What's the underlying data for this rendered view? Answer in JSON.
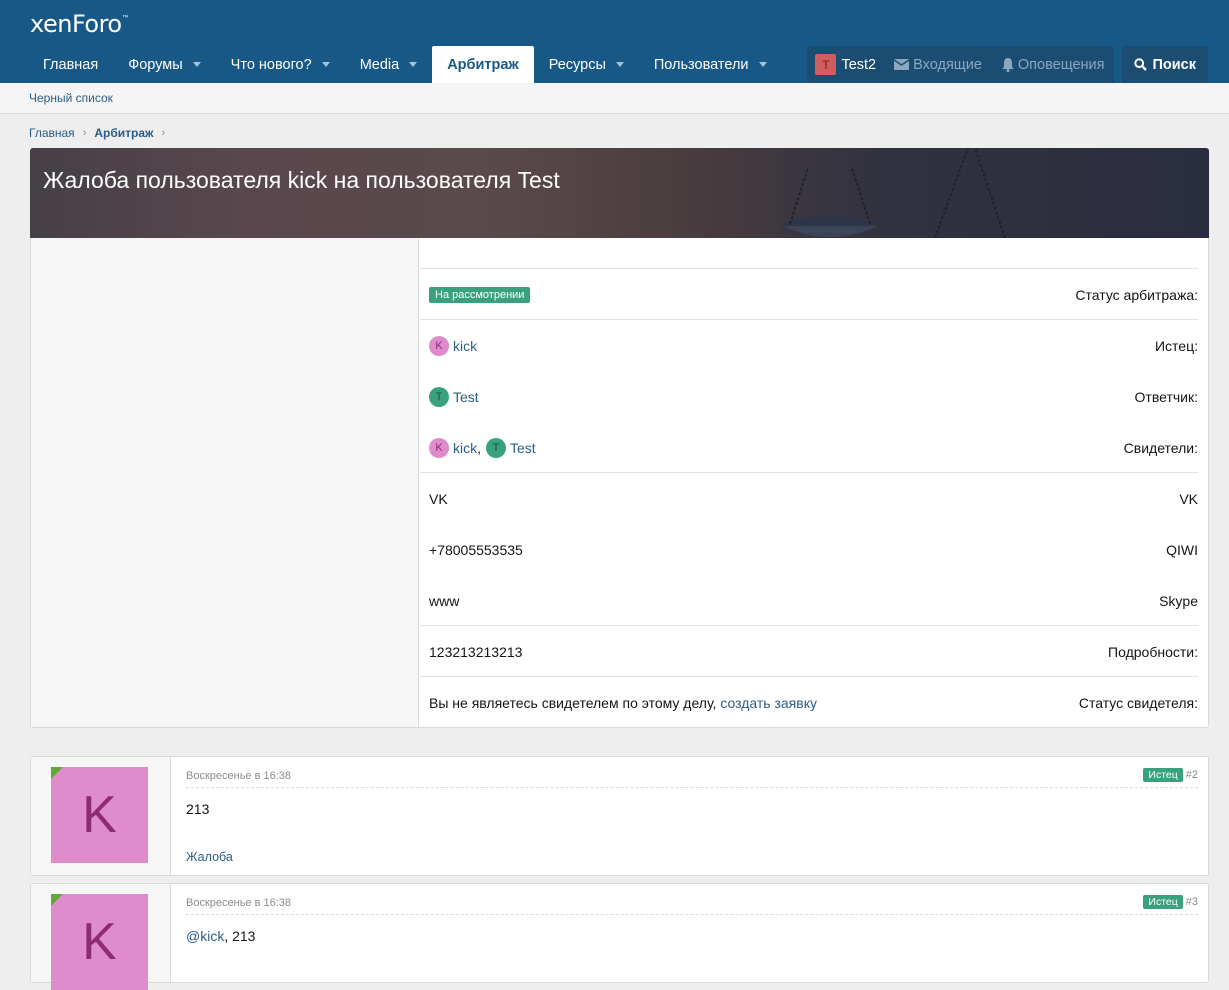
{
  "logo": {
    "text": "xenForo",
    "mark": "™"
  },
  "nav": {
    "tabs": [
      {
        "label": "Главная",
        "caret": false,
        "active": false
      },
      {
        "label": "Форумы",
        "caret": true,
        "active": false
      },
      {
        "label": "Что нового?",
        "caret": true,
        "active": false
      },
      {
        "label": "Media",
        "caret": true,
        "active": false
      },
      {
        "label": "Арбитраж",
        "caret": false,
        "active": true
      },
      {
        "label": "Ресурсы",
        "caret": true,
        "active": false
      },
      {
        "label": "Пользователи",
        "caret": true,
        "active": false
      }
    ],
    "user": {
      "initial": "T",
      "name": "Test2"
    },
    "inbox": "Входящие",
    "alerts": "Оповещения",
    "search": "Поиск"
  },
  "subnav": {
    "link": "Черный список"
  },
  "breadcrumb": {
    "items": [
      "Главная",
      "Арбитраж"
    ]
  },
  "banner": {
    "title": "Жалоба пользователя kick на пользователя Test"
  },
  "info": {
    "status_label": "Статус арбитража:",
    "status_value": "На рассмотрении",
    "plaintiff_label": "Истец:",
    "plaintiff": {
      "initial": "K",
      "name": "kick"
    },
    "defendant_label": "Ответчик:",
    "defendant": {
      "initial": "T",
      "name": "Test"
    },
    "witnesses_label": "Свидетели:",
    "witnesses": [
      {
        "initial": "K",
        "name": "kick"
      },
      {
        "initial": "T",
        "name": "Test"
      }
    ],
    "witness_sep": ",",
    "vk_label": "VK",
    "vk_value": "VK",
    "qiwi_label": "QIWI",
    "qiwi_value": "+78005553535",
    "skype_label": "Skype",
    "skype_value": "www",
    "details_label": "Подробности:",
    "details_value": "123213213213",
    "witness_status_label": "Статус свидетеля:",
    "witness_status_text": "Вы не являетесь свидетелем по этому делу,",
    "witness_status_link": "создать заявку"
  },
  "posts": [
    {
      "avatar": "K",
      "date": "Воскресенье в 16:38",
      "role": "Истец",
      "num": "#2",
      "mention": "",
      "body": "213",
      "report": "Жалоба"
    },
    {
      "avatar": "K",
      "date": "Воскресенье в 16:38",
      "role": "Истец",
      "num": "#3",
      "mention": "@kick",
      "body": ", 213",
      "report": ""
    }
  ],
  "colors": {
    "header": "#185886",
    "accent": "#2b5d86",
    "badge": "#3aa17e",
    "avatar_k": "#df8ccc"
  }
}
